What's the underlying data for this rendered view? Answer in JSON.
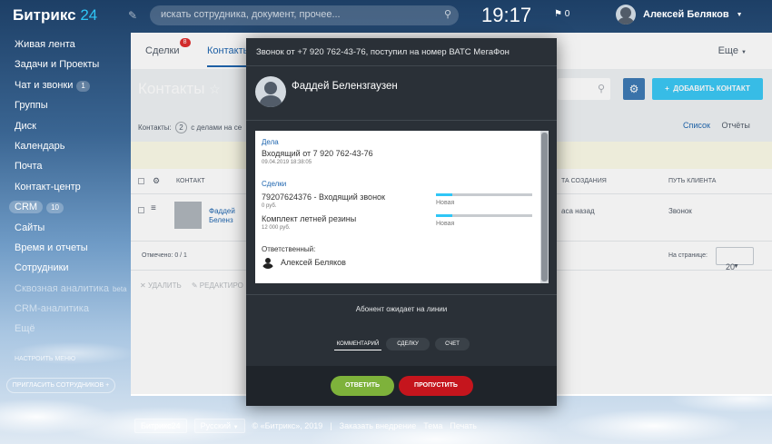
{
  "topbar": {
    "logo_name": "Битрикс",
    "logo_num": "24",
    "search_placeholder": "искать сотрудника, документ, прочее...",
    "clock": "19:17",
    "flag_count": "0",
    "user_name": "Алексей Беляков"
  },
  "sidebar": {
    "items": [
      {
        "label": "Живая лента"
      },
      {
        "label": "Задачи и Проекты"
      },
      {
        "label": "Чат и звонки",
        "badge": "1"
      },
      {
        "label": "Группы"
      },
      {
        "label": "Диск"
      },
      {
        "label": "Календарь"
      },
      {
        "label": "Почта"
      },
      {
        "label": "Контакт-центр"
      },
      {
        "label": "CRM",
        "badge": "10"
      },
      {
        "label": "Сайты"
      },
      {
        "label": "Время и отчеты"
      },
      {
        "label": "Сотрудники"
      },
      {
        "label": "Сквозная аналитика",
        "suffix": "beta"
      },
      {
        "label": "CRM-аналитика"
      },
      {
        "label": "Ещё"
      }
    ],
    "setup_menu": "Настроить меню",
    "invite_button": "Пригласить сотрудников +"
  },
  "crm": {
    "tabs": [
      {
        "label": "Сделки",
        "badge": "8"
      },
      {
        "label": "Контакты"
      }
    ],
    "more": "Еще",
    "title": "Контакты",
    "add_button": "Добавить контакт",
    "counter_prefix": "Контакты:",
    "counter_value": "2",
    "counter_suffix": "с делами на се",
    "view_list": "Список",
    "view_reports": "Отчёты",
    "columns": {
      "contact": "Контакт",
      "created": "та создания",
      "path": "Путь клиента"
    },
    "row": {
      "name_line1": "Фаддей",
      "name_line2": "Беленз",
      "created": "аса назад",
      "path": "Звонок"
    },
    "footer": {
      "marked": "Отмечено: 0 / 1",
      "per_page_label": "На странице:",
      "per_page_value": "20"
    },
    "actions": {
      "delete": "Удалить",
      "edit": "Редактиро"
    }
  },
  "footer": {
    "brand": "Битрикс24",
    "language": "Русский",
    "copyright": "© «Битрикс», 2019",
    "order": "Заказать внедрение",
    "theme": "Тема",
    "print": "Печать"
  },
  "call": {
    "title": "Звонок от +7 920 762-43-76, поступил на номер ВАТС МегаФон",
    "caller": "Фаддей Белензгаузен",
    "activities_label": "Дела",
    "activity_title": "Входящий от 7 920 762-43-76",
    "activity_date": "09.04.2019 18:38:05",
    "deals_label": "Сделки",
    "deals": [
      {
        "title": "79207624376 - Входящий звонок",
        "amount": "0 руб.",
        "stage": "Новая",
        "progress": 0.17
      },
      {
        "title": "Комплект летней резины",
        "amount": "12 000 руб.",
        "stage": "Новая",
        "progress": 0.17
      }
    ],
    "responsible_label": "Ответственный:",
    "responsible_name": "Алексей Беляков",
    "waiting": "Абонент ожидает на линии",
    "btn_comment": "Комментарий",
    "btn_deal": "Сделку",
    "btn_invoice": "Счет",
    "btn_answer": "Ответить",
    "btn_skip": "Пропустить"
  }
}
